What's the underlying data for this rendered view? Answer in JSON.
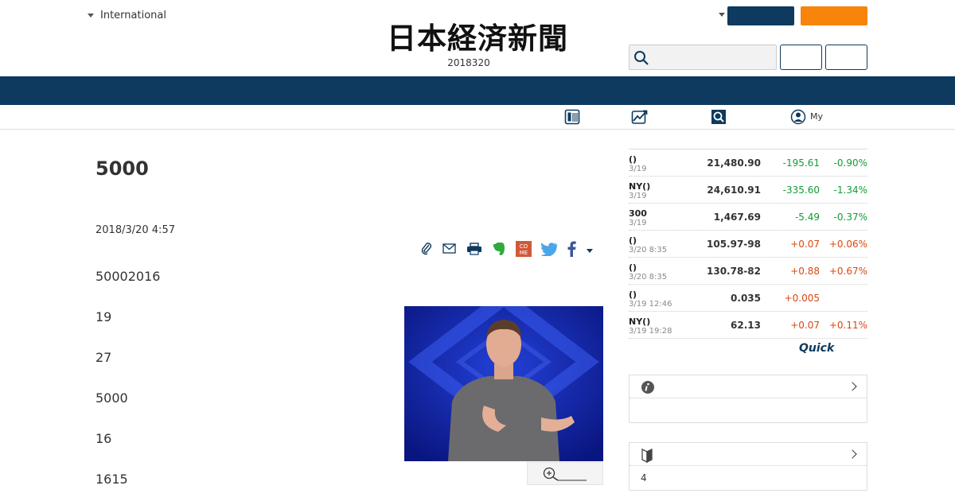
{
  "header": {
    "edition_label": "International",
    "logo_text": "日本経済新聞",
    "issue_date": "2018320",
    "search_placeholder": ""
  },
  "subnav": {
    "my_label": "My"
  },
  "article": {
    "title": "5000",
    "published": "2018/3/20 4:57",
    "paragraphs": [
      "50002016",
      "19",
      "27",
      "5000",
      "16",
      "1615"
    ]
  },
  "market": {
    "rows": [
      {
        "name": "()",
        "time": "3/19",
        "value": "21,480.90",
        "change": "-195.61",
        "pct": "-0.90%",
        "dir": "down"
      },
      {
        "name": "NY()",
        "time": "3/19",
        "value": "24,610.91",
        "change": "-335.60",
        "pct": "-1.34%",
        "dir": "down"
      },
      {
        "name": "300",
        "time": "3/19",
        "value": "1,467.69",
        "change": "-5.49",
        "pct": "-0.37%",
        "dir": "down"
      },
      {
        "name": "()",
        "time": "3/20 8:35",
        "value": "105.97-98",
        "change": "+0.07",
        "pct": "+0.06%",
        "dir": "up"
      },
      {
        "name": "()",
        "time": "3/20 8:35",
        "value": "130.78-82",
        "change": "+0.88",
        "pct": "+0.67%",
        "dir": "up"
      },
      {
        "name": "()",
        "time": "3/19 12:46",
        "value": "0.035",
        "change": "+0.005",
        "pct": "",
        "dir": "up"
      },
      {
        "name": "NY()",
        "time": "3/19 19:28",
        "value": "62.13",
        "change": "+0.07",
        "pct": "+0.11%",
        "dir": "up"
      }
    ],
    "provider": "Quick"
  },
  "panels": {
    "info_body": "",
    "beginner_body": "4"
  },
  "colors": {
    "navy": "#0d3a5e",
    "orange": "#f7840b",
    "down": "#139c35",
    "up": "#d9480f"
  }
}
